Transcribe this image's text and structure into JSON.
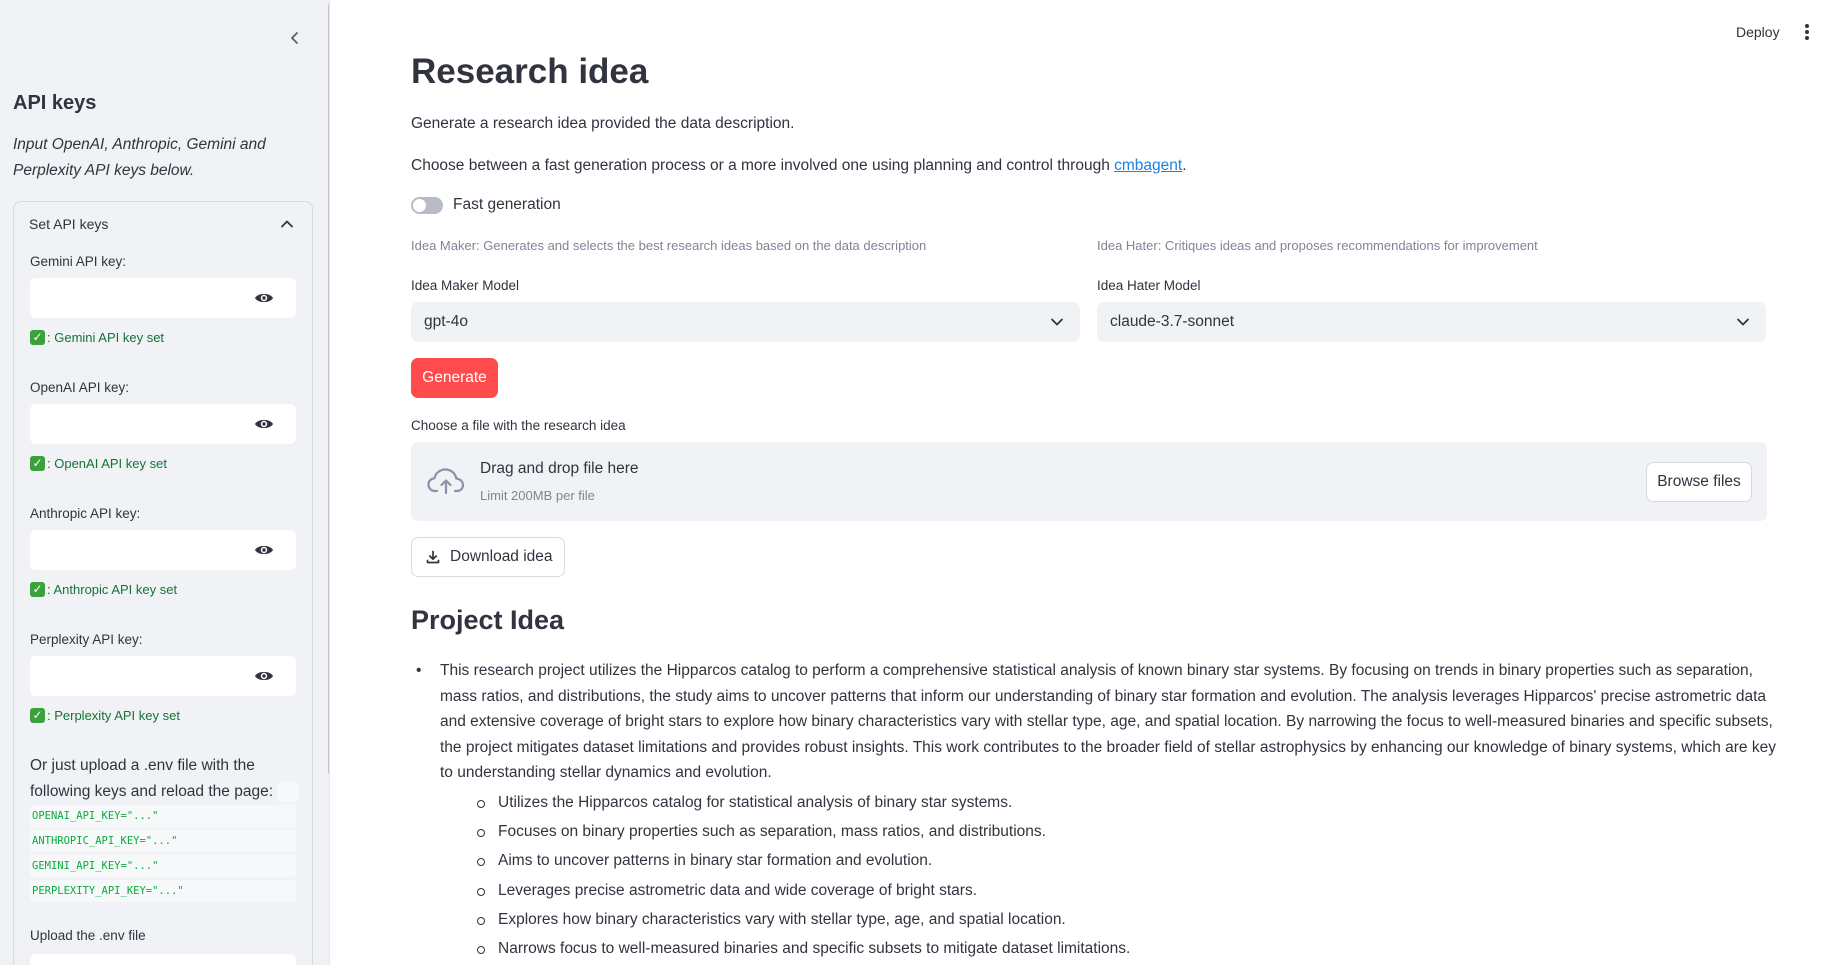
{
  "sidebar": {
    "title": "API keys",
    "description": "Input OpenAI, Anthropic, Gemini and Perplexity API keys below.",
    "expander_title": "Set API keys",
    "fields": [
      {
        "label": "Gemini API key:",
        "value": "",
        "status": ": Gemini API key set"
      },
      {
        "label": "OpenAI API key:",
        "value": "",
        "status": ": OpenAI API key set"
      },
      {
        "label": "Anthropic API key:",
        "value": "",
        "status": ": Anthropic API key set"
      },
      {
        "label": "Perplexity API key:",
        "value": "",
        "status": ": Perplexity API key set"
      }
    ],
    "env_text": "Or just upload a .env file with the following keys and reload the page:",
    "env_lines": [
      "OPENAI_API_KEY=\"...\"",
      "ANTHROPIC_API_KEY=\"...\"",
      "GEMINI_API_KEY=\"...\"",
      "PERPLEXITY_API_KEY=\"...\""
    ],
    "upload_label": "Upload the .env file"
  },
  "toolbar": {
    "deploy_label": "Deploy"
  },
  "main": {
    "title": "Research idea",
    "intro": "Generate a research idea provided the data description.",
    "choose_text": "Choose between a fast generation process or a more involved one using planning and control through ",
    "choose_link": "cmbagent",
    "choose_end": ".",
    "toggle_label": "Fast generation",
    "toggle_on": false,
    "maker_caption": "Idea Maker: Generates and selects the best research ideas based on the data description",
    "hater_caption": "Idea Hater: Critiques ideas and proposes recommendations for improvement",
    "maker_label": "Idea Maker Model",
    "maker_value": "gpt-4o",
    "hater_label": "Idea Hater Model",
    "hater_value": "claude-3.7-sonnet",
    "generate_label": "Generate",
    "file_label": "Choose a file with the research idea",
    "dropzone_title": "Drag and drop file here",
    "dropzone_limit": "Limit 200MB per file",
    "browse_label": "Browse files",
    "download_label": "Download idea",
    "project_heading": "Project Idea",
    "project_paragraph": "This research project utilizes the Hipparcos catalog to perform a comprehensive statistical analysis of known binary star systems. By focusing on trends in binary properties such as separation, mass ratios, and distributions, the study aims to uncover patterns that inform our understanding of binary star formation and evolution. The analysis leverages Hipparcos' precise astrometric data and extensive coverage of bright stars to explore how binary characteristics vary with stellar type, age, and spatial location. By narrowing the focus to well-measured binaries and specific subsets, the project mitigates dataset limitations and provides robust insights. This work contributes to the broader field of stellar astrophysics by enhancing our knowledge of binary systems, which are key to understanding stellar dynamics and evolution.",
    "project_points": [
      "Utilizes the Hipparcos catalog for statistical analysis of binary star systems.",
      "Focuses on binary properties such as separation, mass ratios, and distributions.",
      "Aims to uncover patterns in binary star formation and evolution.",
      "Leverages precise astrometric data and wide coverage of bright stars.",
      "Explores how binary characteristics vary with stellar type, age, and spatial location.",
      "Narrows focus to well-measured binaries and specific subsets to mitigate dataset limitations."
    ]
  },
  "colors": {
    "primary": "#ff4b4b",
    "sidebar_bg": "#f0f2f6",
    "success_text": "#177233",
    "link": "#1c83e1"
  },
  "icons": [
    "chevron-left-icon",
    "chevron-up-icon",
    "eye-icon",
    "check-icon",
    "kebab-menu-icon",
    "chevron-down-icon",
    "cloud-upload-icon",
    "download-icon"
  ]
}
